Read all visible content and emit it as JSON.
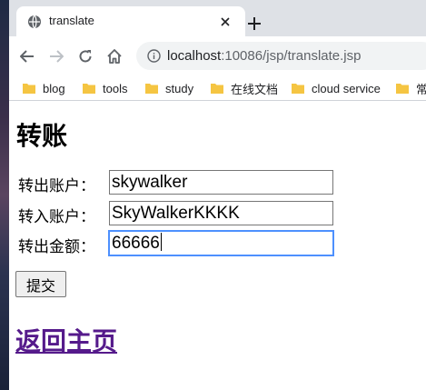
{
  "browser": {
    "tab": {
      "title": "translate",
      "favicon": "globe-icon"
    },
    "url": {
      "host": "localhost",
      "path": ":10086/jsp/translate.jsp"
    },
    "bookmarks": [
      "blog",
      "tools",
      "study",
      "在线文档",
      "cloud service",
      "常"
    ]
  },
  "page": {
    "title": "转账",
    "form": {
      "from_label": "转出账户：",
      "from_value": "skywalker",
      "to_label": "转入账户：",
      "to_value": "SkyWalkerKKKK",
      "amount_label": "转出金额：",
      "amount_value": "66666",
      "submit_label": "提交"
    },
    "home_link": "返回主页"
  },
  "colors": {
    "link_visited": "#551a8b",
    "focus_ring": "#4d90fe",
    "tabstrip": "#dee1e6",
    "folder": "#f5c542"
  }
}
